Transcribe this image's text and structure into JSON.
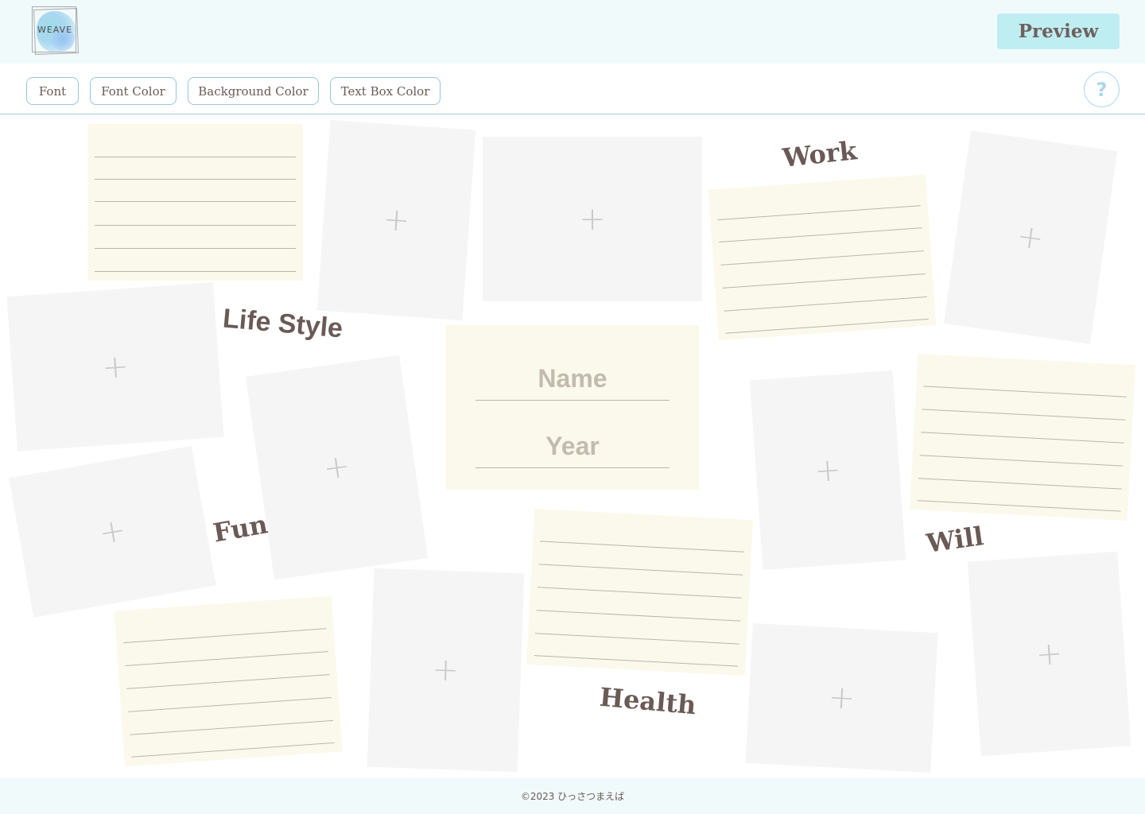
{
  "header": {
    "logo_text": "WEAVE",
    "preview_label": "Preview"
  },
  "toolbar": {
    "font_label": "Font",
    "font_color_label": "Font Color",
    "background_color_label": "Background Color",
    "text_box_color_label": "Text Box Color",
    "help_label": "?"
  },
  "canvas": {
    "add_photo_symbol": "+",
    "categories": {
      "work": "Work",
      "life_style": "Life Style",
      "fun": "Fun",
      "will": "Will",
      "health": "Health"
    },
    "name_card": {
      "name_placeholder": "Name",
      "year_placeholder": "Year"
    }
  },
  "colors": {
    "header_bg": "#f1fafb",
    "preview_button_bg": "#bfeef2",
    "text_brown": "#6a5a56",
    "note_bg": "#fbf9ec",
    "photo_placeholder_bg": "#f5f5f5",
    "accent_border": "#97c7d7"
  },
  "footer": {
    "copyright": "©2023 ひっさつまえば"
  }
}
